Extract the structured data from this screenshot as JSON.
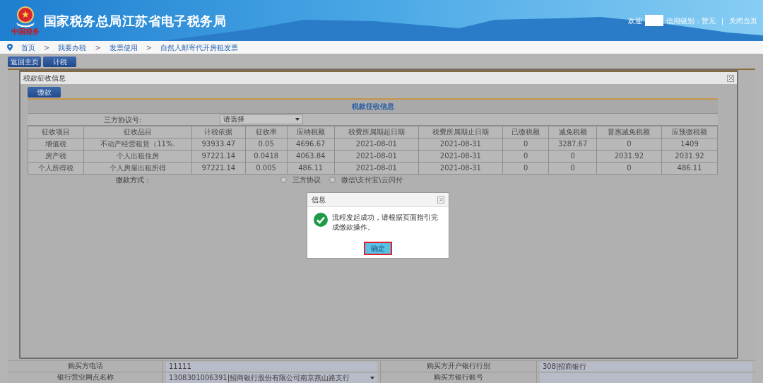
{
  "header": {
    "emblem_caption": "中国税务",
    "title": "国家税务总局江苏省电子税务局",
    "welcome": "欢迎",
    "credit": "信用级别：暂无",
    "separator": "|",
    "close": "关闭当页"
  },
  "breadcrumb": {
    "separator": ">",
    "items": [
      "首页",
      "我要办税",
      "发票使用",
      "自然人邮寄代开房租发票"
    ]
  },
  "toolbar": [
    "返回主页",
    "计税"
  ],
  "background_form": {
    "rows": [
      {
        "label_1": "购买方电话",
        "value_1": "11111",
        "label_2": "购买方开户银行行别",
        "value_2": "308|招商银行"
      },
      {
        "label_1": "银行营业网点名称",
        "value_1": "1308301006391|招商银行股份有限公司南京燕山路支行",
        "label_2": "购买方银行账号",
        "value_2": ""
      }
    ]
  },
  "modal": {
    "title": "税款征收信息",
    "pay_button": "缴款",
    "table_caption": "税款征收信息",
    "agreement_label": "三方协议号:",
    "agreement_value": "请选择",
    "columns": [
      "征收项目",
      "征收品目",
      "计税依据",
      "征收率",
      "应纳税额",
      "税费所属期起日期",
      "税费所属期止日期",
      "已缴税额",
      "减免税额",
      "普惠减免税额",
      "应预缴税额"
    ],
    "rows": [
      [
        "增值税",
        "不动产经营租赁（11%.",
        "93933.47",
        "0.05",
        "4696.67",
        "2021-08-01",
        "2021-08-31",
        "0",
        "3287.67",
        "0",
        "1409"
      ],
      [
        "房产税",
        "个人出租住房",
        "97221.14",
        "0.0418",
        "4063.84",
        "2021-08-01",
        "2021-08-31",
        "0",
        "0",
        "2031.92",
        "2031.92"
      ],
      [
        "个人所得税",
        "个人房屋出租所得",
        "97221.14",
        "0.005",
        "486.11",
        "2021-08-01",
        "2021-08-31",
        "0",
        "0",
        "0",
        "486.11"
      ]
    ],
    "payment_label": "缴款方式：",
    "payment_options": [
      {
        "label": "三方协议",
        "selected": false
      },
      {
        "label": "微信\\支付宝\\云闪付",
        "selected": false
      }
    ]
  },
  "dialog": {
    "title": "信息",
    "message": "流程发起成功，请根据页面指引完成缴款操作。",
    "ok_button": "确定",
    "ok_highlighted": true
  }
}
